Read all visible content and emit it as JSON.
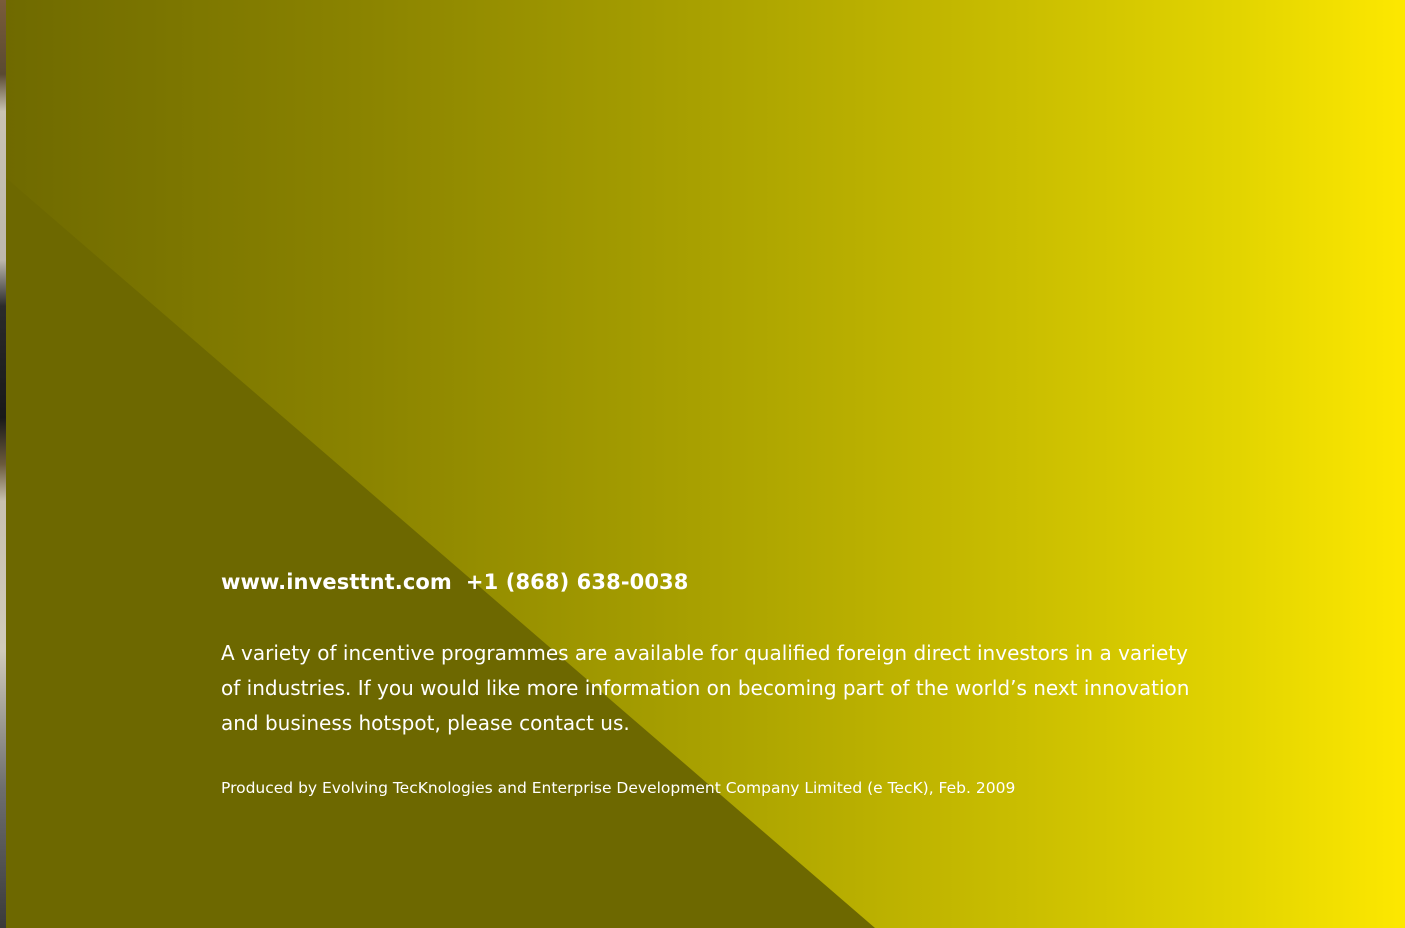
{
  "contact": {
    "website": "www.investtnt.com",
    "phone": "+1 (868) 638-0038"
  },
  "body": {
    "paragraph": "A variety of incentive programmes are available for qualified foreign direct investors in a variety of industries. If you would like more information on becoming part of the world’s next innovation and business hotspot, please contact us."
  },
  "footer": {
    "credit": "Produced by Evolving TecKnologies and Enterprise Development Company Limited (e TecK), Feb. 2009"
  },
  "colors": {
    "text": "#ffffff",
    "shade": "#6f6a00",
    "gradient_start": "#6f6a00",
    "gradient_end": "#fde800"
  }
}
